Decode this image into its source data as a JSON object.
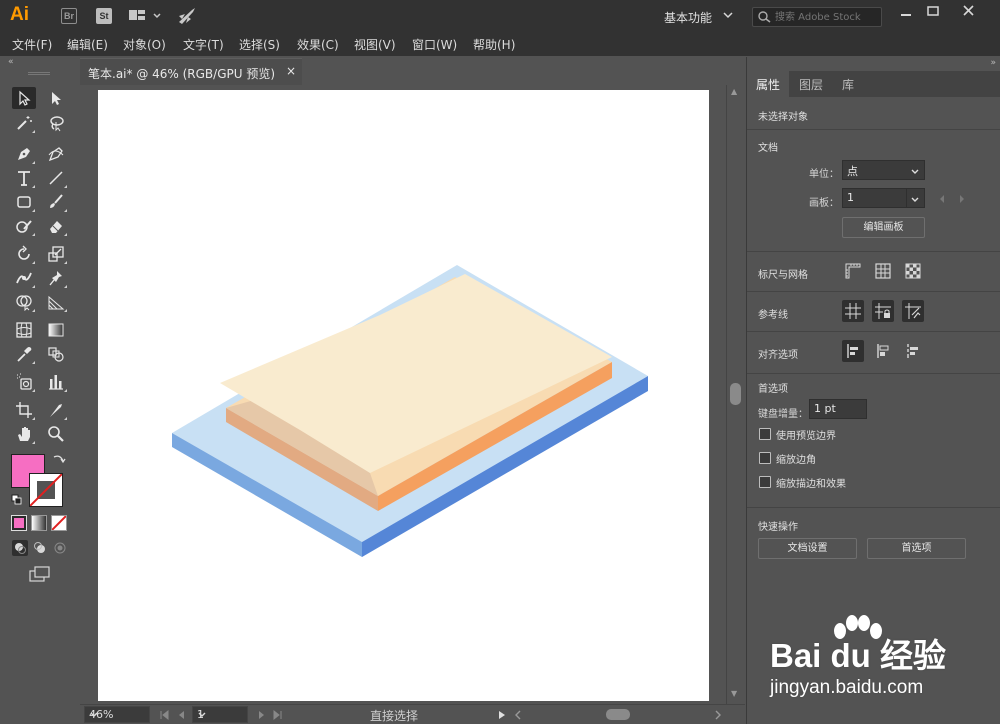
{
  "app": {
    "logo": "Ai",
    "bridge": "Br",
    "stock": "St",
    "workspace": "基本功能",
    "stock_search_placeholder": "搜索 Adobe Stock"
  },
  "menu": [
    "文件(F)",
    "编辑(E)",
    "对象(O)",
    "文字(T)",
    "选择(S)",
    "效果(C)",
    "视图(V)",
    "窗口(W)",
    "帮助(H)"
  ],
  "document": {
    "tab_title": "笔本.ai* @ 46% (RGB/GPU 预览)",
    "close": "×"
  },
  "colors": {
    "fill": "#f66ec2",
    "artwork_blue_top": "#c8e0f4",
    "artwork_blue_side": "#5586d7",
    "artwork_orange_side": "#f5a05f",
    "artwork_paper": "#f9ebcf"
  },
  "status": {
    "zoom": "46%",
    "artboard_number": "1",
    "tool": "直接选择"
  },
  "panel": {
    "tabs": [
      "属性",
      "图层",
      "库"
    ],
    "no_selection": "未选择对象",
    "document_section": "文档",
    "units_label": "单位：",
    "units_value": "点",
    "artboard_label": "画板：",
    "artboard_value": "1",
    "edit_artboards_button": "编辑画板",
    "rulers_grids": "标尺与网格",
    "guides": "参考线",
    "align_options": "对齐选项",
    "preferences_section": "首选项",
    "keyboard_increment_label": "键盘增量：",
    "keyboard_increment_value": "1 pt",
    "use_preview_bounds": "使用预览边界",
    "scale_corners": "缩放边角",
    "scale_strokes_effects": "缩放描边和效果",
    "quick_actions": "快速操作",
    "document_setup_button": "文档设置",
    "preferences_button": "首选项"
  },
  "watermark": {
    "brand": "Bai du 经验",
    "url": "jingyan.baidu.com"
  }
}
